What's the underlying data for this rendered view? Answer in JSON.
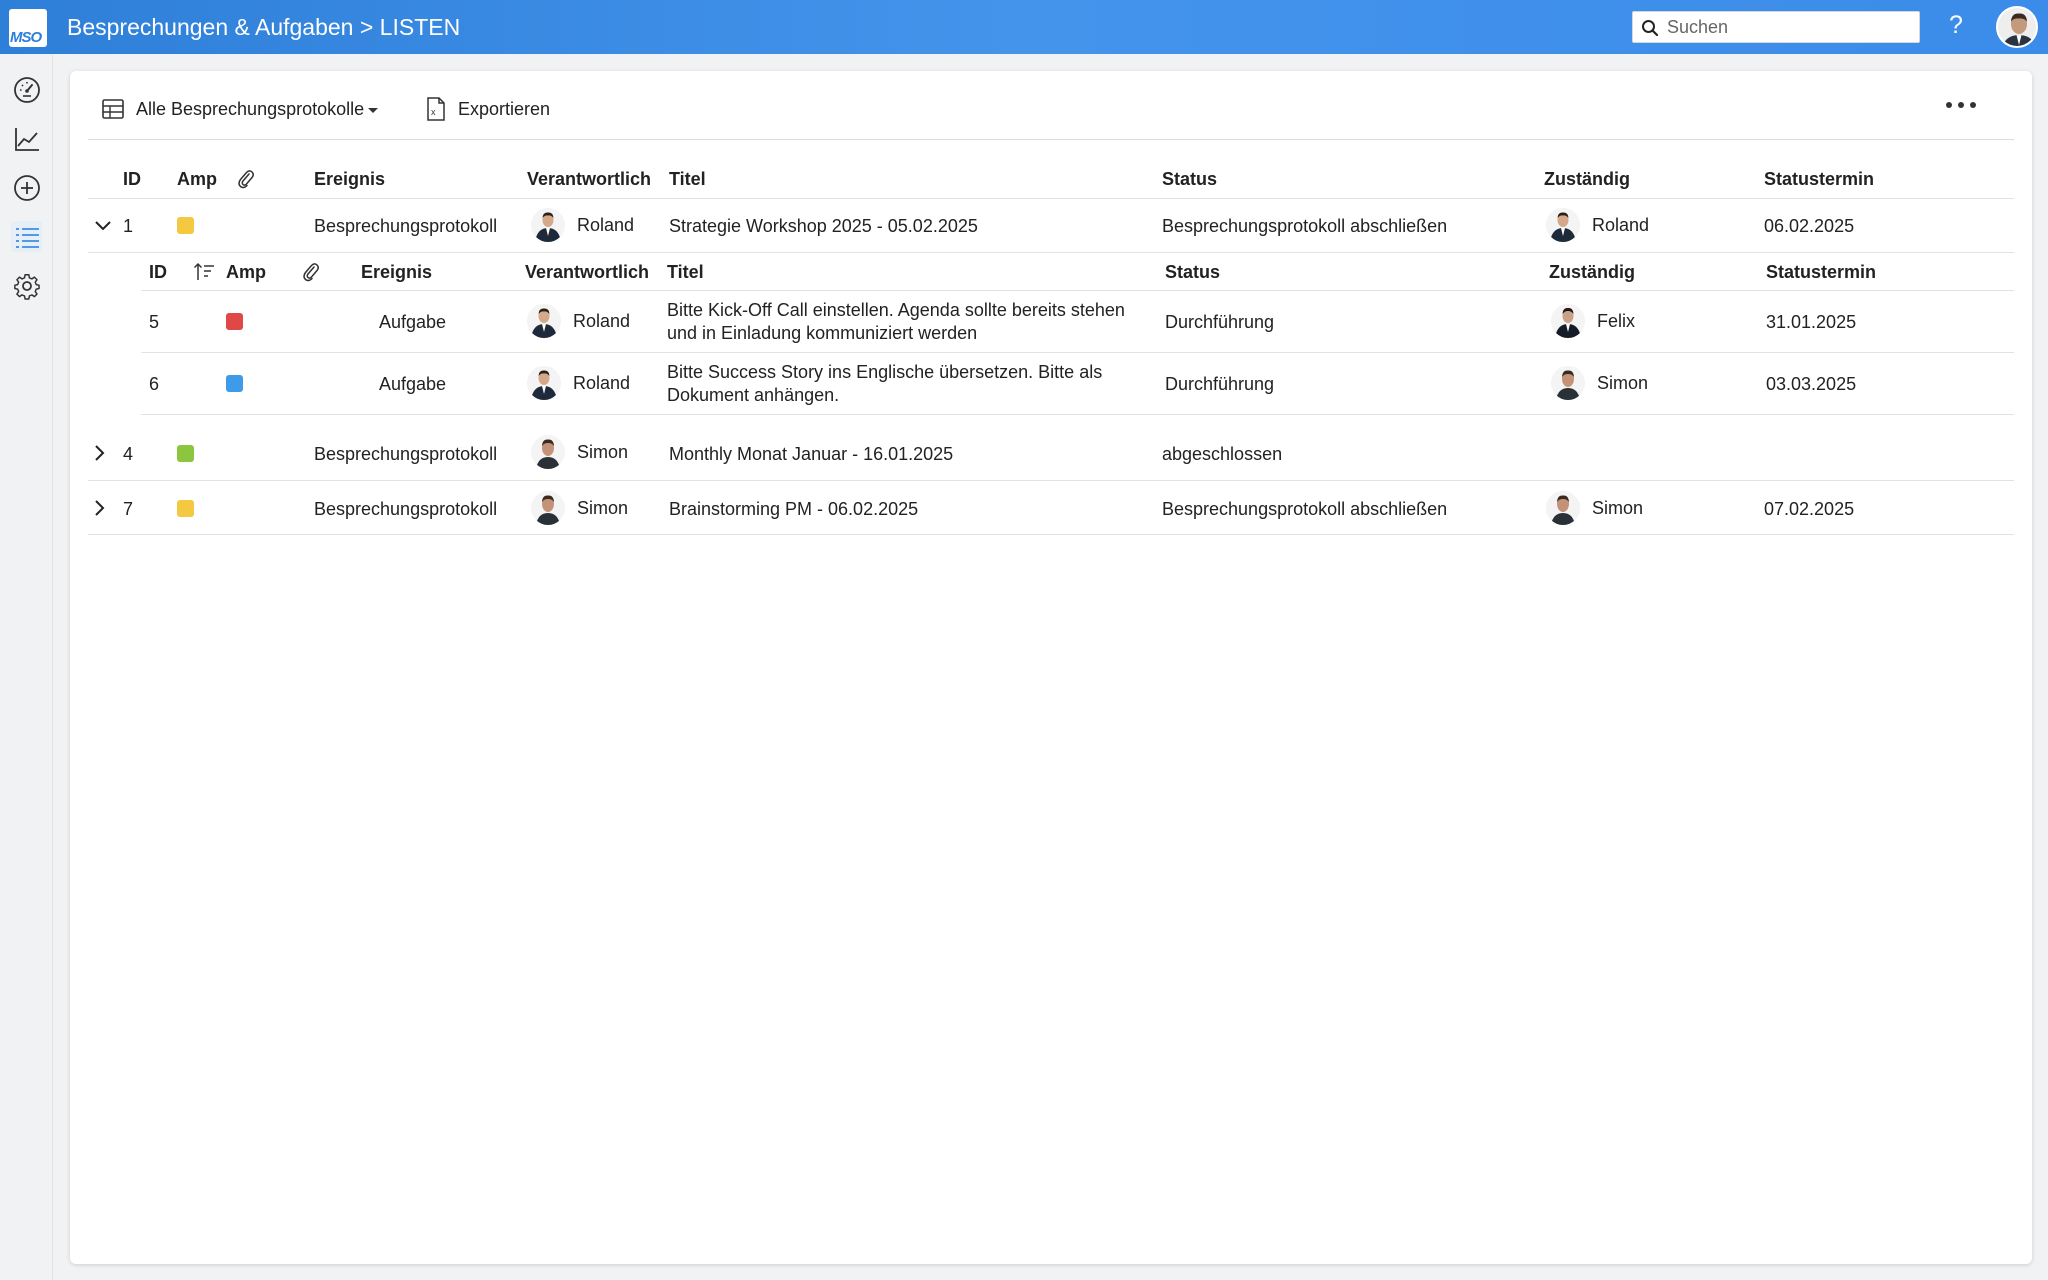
{
  "header": {
    "logo_text": "MSO",
    "title": "Besprechungen & Aufgaben > LISTEN",
    "search_placeholder": "Suchen",
    "help_label": "?"
  },
  "sidebar": {
    "items": [
      {
        "name": "dashboard",
        "icon": "gauge-icon"
      },
      {
        "name": "analytics",
        "icon": "line-chart-icon"
      },
      {
        "name": "add",
        "icon": "plus-circle-icon"
      },
      {
        "name": "lists",
        "icon": "list-icon",
        "active": true
      },
      {
        "name": "settings",
        "icon": "gear-icon"
      }
    ]
  },
  "toolbar": {
    "view_label": "Alle Besprechungsprotokolle",
    "export_label": "Exportieren"
  },
  "table": {
    "columns": [
      "ID",
      "Amp",
      "Ereignis",
      "Verantwortlich",
      "Titel",
      "Status",
      "Zuständig",
      "Statustermin"
    ],
    "rows": [
      {
        "id": "1",
        "amp_color": "#f5c842",
        "ereignis": "Besprechungsprotokoll",
        "verantwortlich": "Roland",
        "titel": "Strategie Workshop 2025 - 05.02.2025",
        "status": "Besprechungsprotokoll abschließen",
        "zustaendig": "Roland",
        "statustermin": "06.02.2025",
        "expanded": true
      },
      {
        "id": "4",
        "amp_color": "#8cc63f",
        "ereignis": "Besprechungsprotokoll",
        "verantwortlich": "Simon",
        "titel": "Monthly Monat Januar - 16.01.2025",
        "status": "abgeschlossen",
        "zustaendig": "",
        "statustermin": "",
        "expanded": false
      },
      {
        "id": "7",
        "amp_color": "#f5c842",
        "ereignis": "Besprechungsprotokoll",
        "verantwortlich": "Simon",
        "titel": "Brainstorming PM - 06.02.2025",
        "status": "Besprechungsprotokoll abschließen",
        "zustaendig": "Simon",
        "statustermin": "07.02.2025",
        "expanded": false
      }
    ]
  },
  "subtable": {
    "columns": [
      "ID",
      "Amp",
      "Ereignis",
      "Verantwortlich",
      "Titel",
      "Status",
      "Zuständig",
      "Statustermin"
    ],
    "rows": [
      {
        "id": "5",
        "amp_color": "#e04848",
        "ereignis": "Aufgabe",
        "verantwortlich": "Roland",
        "titel": "Bitte Kick-Off Call einstellen. Agenda sollte bereits stehen und in Einladung kommuniziert werden",
        "status": "Durchführung",
        "zustaendig": "Felix",
        "statustermin": "31.01.2025"
      },
      {
        "id": "6",
        "amp_color": "#3d9be9",
        "ereignis": "Aufgabe",
        "verantwortlich": "Roland",
        "titel": "Bitte Success Story ins Englische übersetzen. Bitte als Dokument anhängen.",
        "status": "Durchführung",
        "zustaendig": "Simon",
        "statustermin": "03.03.2025"
      }
    ]
  }
}
